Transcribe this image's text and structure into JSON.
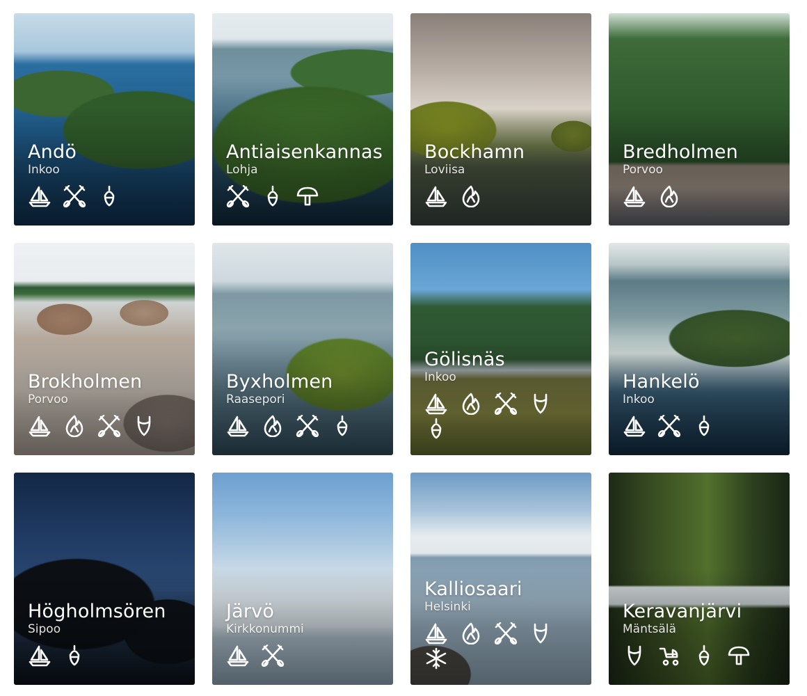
{
  "cards": [
    {
      "name": "Andö",
      "place": "Inkoo",
      "icons": [
        "sailboat-icon",
        "crossed-oars-icon",
        "buoy-icon"
      ]
    },
    {
      "name": "Antiaisenkannas",
      "place": "Lohja",
      "icons": [
        "crossed-oars-icon",
        "buoy-icon",
        "mushroom-icon"
      ]
    },
    {
      "name": "Bockhamn",
      "place": "Loviisa",
      "icons": [
        "sailboat-icon",
        "campfire-icon"
      ]
    },
    {
      "name": "Bredholmen",
      "place": "Porvoo",
      "icons": [
        "sailboat-icon",
        "campfire-icon"
      ]
    },
    {
      "name": "Brokholmen",
      "place": "Porvoo",
      "icons": [
        "sailboat-icon",
        "campfire-icon",
        "crossed-oars-icon",
        "swimsuit-icon"
      ]
    },
    {
      "name": "Byxholmen",
      "place": "Raasepori",
      "icons": [
        "sailboat-icon",
        "campfire-icon",
        "crossed-oars-icon",
        "buoy-icon"
      ]
    },
    {
      "name": "Gölisnäs",
      "place": "Inkoo",
      "icons": [
        "sailboat-icon",
        "campfire-icon",
        "crossed-oars-icon",
        "swimsuit-icon",
        "buoy-icon"
      ]
    },
    {
      "name": "Hankelö",
      "place": "Inkoo",
      "icons": [
        "sailboat-icon",
        "crossed-oars-icon",
        "buoy-icon"
      ]
    },
    {
      "name": "Högholmsören",
      "place": "Sipoo",
      "icons": [
        "sailboat-icon",
        "buoy-icon"
      ]
    },
    {
      "name": "Järvö",
      "place": "Kirkkonummi",
      "icons": [
        "sailboat-icon",
        "crossed-oars-icon"
      ]
    },
    {
      "name": "Kalliosaari",
      "place": "Helsinki",
      "icons": [
        "sailboat-icon",
        "campfire-icon",
        "crossed-oars-icon",
        "swimsuit-icon",
        "snowflake-icon"
      ]
    },
    {
      "name": "Keravanjärvi",
      "place": "Mäntsälä",
      "icons": [
        "swimsuit-icon",
        "stroller-icon",
        "buoy-icon",
        "mushroom-icon"
      ]
    }
  ]
}
